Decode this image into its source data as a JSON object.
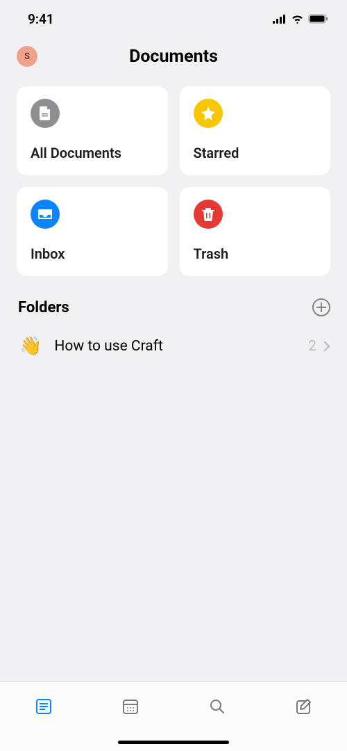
{
  "status": {
    "time": "9:41"
  },
  "header": {
    "avatar_initial": "S",
    "title": "Documents"
  },
  "cards": {
    "all_documents": "All Documents",
    "starred": "Starred",
    "inbox": "Inbox",
    "trash": "Trash"
  },
  "folders_section": {
    "title": "Folders"
  },
  "folders": [
    {
      "emoji": "👋",
      "name": "How to use Craft",
      "count": "2"
    }
  ]
}
